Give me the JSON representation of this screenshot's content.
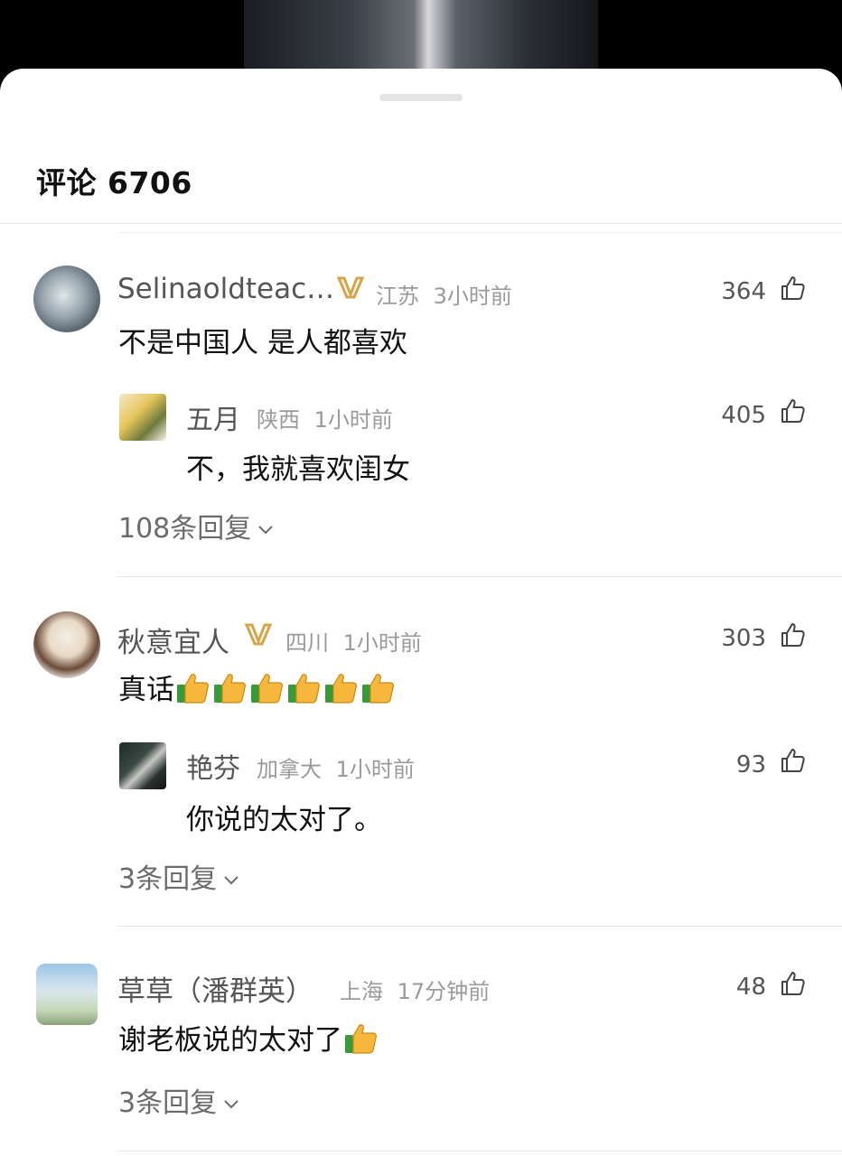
{
  "header": {
    "title": "评论 6706"
  },
  "threads": [
    {
      "name": "Selinaoldteac…",
      "location": "江苏",
      "time": "3小时前",
      "likes": "364",
      "text": "不是中国人 是人都喜欢",
      "reply": {
        "name": "五月",
        "location": "陕西",
        "time": "1小时前",
        "likes": "405",
        "text": "不，我就喜欢闺女"
      },
      "more": "108条回复"
    },
    {
      "name": "秋意宜人",
      "location": "四川",
      "time": "1小时前",
      "likes": "303",
      "text": "真话",
      "thumbs": 6,
      "reply": {
        "name": "艳芬",
        "location": "加拿大",
        "time": "1小时前",
        "likes": "93",
        "text": "你说的太对了。"
      },
      "more": "3条回复"
    },
    {
      "name": "草草（潘群英）",
      "location": "上海",
      "time": "17分钟前",
      "likes": "48",
      "text": "谢老板说的太对了",
      "thumbs": 1,
      "more": "3条回复"
    }
  ],
  "colors": {
    "badge": "#d7a548",
    "meta": "#9a9a9a",
    "text": "#111111"
  }
}
